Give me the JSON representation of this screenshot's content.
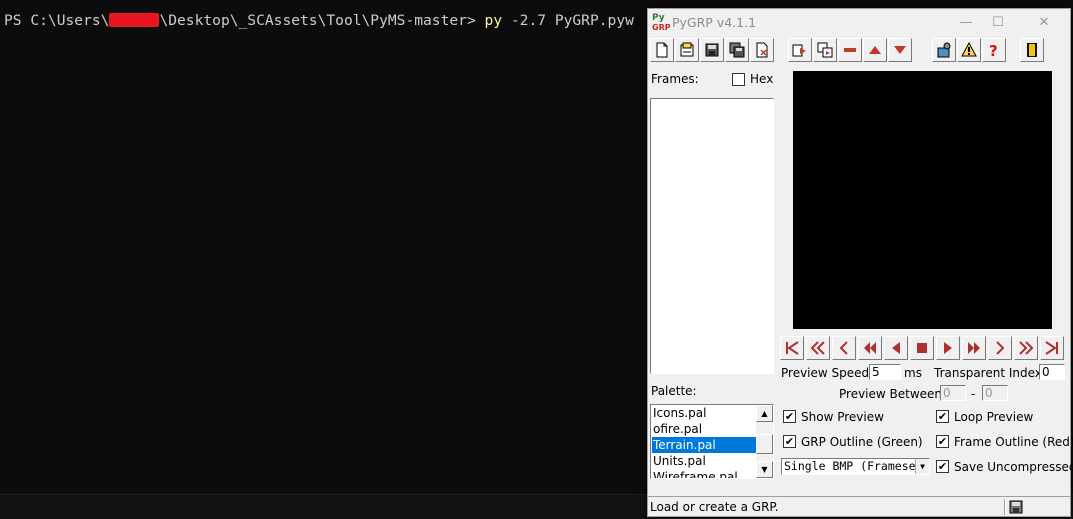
{
  "terminal": {
    "prompt_pre": "PS C:\\Users\\",
    "prompt_post": "\\Desktop\\_SCAssets\\Tool\\PyMS-master> ",
    "command_kw": "py",
    "command_args": " -2.7 PyGRP.pyw"
  },
  "window": {
    "title": "PyGRP v4.1.1",
    "icon_text_top": "Py",
    "icon_text_bottom": "GRP",
    "minimize_glyph": "—",
    "maximize_glyph": "☐",
    "close_glyph": "✕"
  },
  "toolbar": {
    "groups": [
      "file",
      "frames",
      "tools"
    ],
    "icons": [
      "new-icon",
      "open-icon",
      "save-icon",
      "save-as-icon",
      "close-file-icon",
      "import-frames-icon",
      "export-frames-icon",
      "remove-frame-icon",
      "move-up-icon",
      "move-down-icon",
      "settings-icon",
      "palette-warning-icon",
      "help-icon",
      "exit-icon"
    ]
  },
  "frames": {
    "label": "Frames:",
    "hex_label": "Hex",
    "hex_checked": false
  },
  "navigation": {
    "buttons": [
      "first",
      "rewind-far",
      "prev-step",
      "rewind",
      "previous",
      "stop",
      "play",
      "forward",
      "next-step",
      "forward-far",
      "last"
    ]
  },
  "preview": {
    "speed_label": "Preview Speed:",
    "speed_value": "5",
    "speed_unit": "ms",
    "transparent_label": "Transparent Index:",
    "transparent_value": "0",
    "between_label": "Preview Between:",
    "between_from": "0",
    "between_dash": "-",
    "between_to": "0"
  },
  "palette": {
    "label": "Palette:",
    "items": [
      "Icons.pal",
      "ofire.pal",
      "Terrain.pal",
      "Units.pal",
      "Wireframe.pal"
    ],
    "selected": "Terrain.pal"
  },
  "options": {
    "show_preview": {
      "label": "Show Preview",
      "checked": true
    },
    "loop_preview": {
      "label": "Loop Preview",
      "checked": true
    },
    "grp_outline": {
      "label": "GRP Outline (Green)",
      "checked": true
    },
    "frame_outline": {
      "label": "Frame Outline (Red)",
      "checked": true
    },
    "save_uncompressed": {
      "label": "Save Uncompressed",
      "checked": true
    },
    "check_mark": "✔"
  },
  "export_mode": {
    "value": "Single BMP (Framesets)"
  },
  "status": {
    "text": "Load or create a GRP."
  },
  "colors": {
    "accent_selection": "#0078d7",
    "terminal_bg": "#0c0c0c",
    "command_yellow": "#f9f1a5",
    "redaction": "#e8141f",
    "icon_red": "#c0392b"
  }
}
